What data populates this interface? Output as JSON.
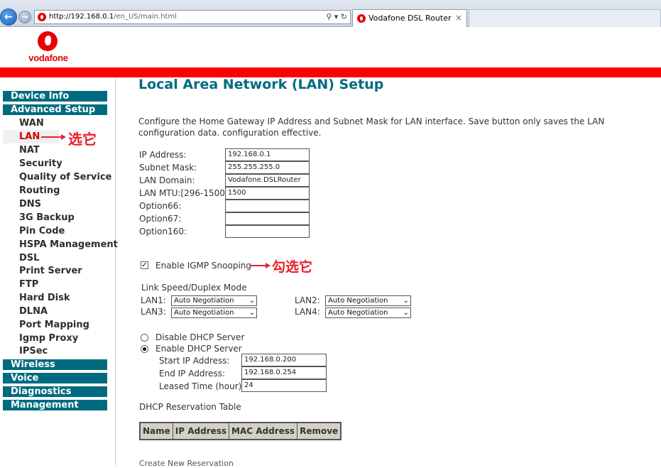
{
  "browser": {
    "url_host": "http://192.168.0.1",
    "url_path": "/en_US/main.html",
    "tab_title": "Vodafone DSL Router"
  },
  "header": {
    "logo_text": "vodafone"
  },
  "sidebar": {
    "categories": [
      "Device Info",
      "Advanced Setup",
      "Wireless",
      "Voice",
      "Diagnostics",
      "Management"
    ],
    "advanced_items": [
      "WAN",
      "LAN",
      "NAT",
      "Security",
      "Quality of Service",
      "Routing",
      "DNS",
      "3G Backup",
      "Pin Code",
      "HSPA Management",
      "DSL",
      "Print Server",
      "FTP",
      "Hard Disk",
      "DLNA",
      "Port Mapping",
      "Igmp Proxy",
      "IPSec"
    ]
  },
  "annotations": {
    "lan_note": "选它",
    "igmp_note": "勾选它"
  },
  "main": {
    "title": "Local Area Network (LAN) Setup",
    "description": "Configure the Home Gateway IP Address and Subnet Mask for LAN interface.  Save button only saves the LAN configuration data. configuration effective.",
    "fields": [
      {
        "label": "IP Address:",
        "value": "192.168.0.1"
      },
      {
        "label": "Subnet Mask:",
        "value": "255.255.255.0"
      },
      {
        "label": "LAN Domain:",
        "value": "Vodafone.DSLRouter"
      },
      {
        "label": "LAN MTU:[296-1500]",
        "value": "1500"
      },
      {
        "label": "Option66:",
        "value": ""
      },
      {
        "label": "Option67:",
        "value": ""
      },
      {
        "label": "Option160:",
        "value": ""
      }
    ],
    "igmp_label": "Enable IGMP Snooping",
    "link_speed_title": "Link Speed/Duplex Mode",
    "lan_ports": [
      {
        "label": "LAN1:",
        "value": "Auto Negotiation"
      },
      {
        "label": "LAN2:",
        "value": "Auto Negotiation"
      },
      {
        "label": "LAN3:",
        "value": "Auto Negotiation"
      },
      {
        "label": "LAN4:",
        "value": "Auto Negotiation"
      }
    ],
    "dhcp_disable_label": "Disable DHCP Server",
    "dhcp_enable_label": "Enable DHCP Server",
    "dhcp_fields": [
      {
        "label": "Start IP Address:",
        "value": "192.168.0.200"
      },
      {
        "label": "End IP Address:",
        "value": "192.168.0.254"
      },
      {
        "label": "Leased Time (hour):",
        "value": "24"
      }
    ],
    "reservation_title": "DHCP Reservation Table",
    "reservation_headers": [
      "Name",
      "IP Address",
      "MAC Address",
      "Remove"
    ],
    "cut_off_text": "Create New Reservation"
  }
}
